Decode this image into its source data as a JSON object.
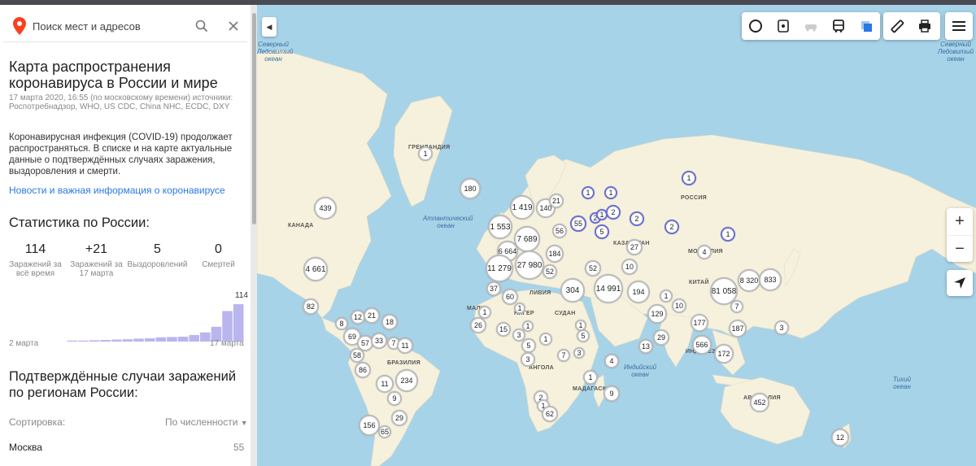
{
  "search": {
    "placeholder": "Поиск мест и адресов"
  },
  "sidebar": {
    "title": "Карта распространения коронавируса в России и мире",
    "meta": "17 марта 2020, 16:55 (по московскому времени) источники: Роспотребнадзор, WHO, US CDC, China NHC, ECDC, DXY",
    "description": "Коронавирусная инфекция (COVID-19) продолжает распространяться. В списке и на карте актуальные данные о подтверждённых случаях заражения, выздоровления и смерти.",
    "link": "Новости и важная информация о коронавирусе",
    "stats_heading": "Статистика по России:",
    "stats": [
      {
        "value": "114",
        "label": "Заражений за всё время"
      },
      {
        "value": "+21",
        "label": "Заражений за 17 марта"
      },
      {
        "value": "5",
        "label": "Выздоровлений"
      },
      {
        "value": "0",
        "label": "Смертей"
      }
    ],
    "regions_heading": "Подтверждённые случаи заражений по регионам России:",
    "sort_label": "Сортировка:",
    "sort_value": "По численности",
    "regions": [
      {
        "name": "Москва",
        "value": "55"
      }
    ]
  },
  "chart_data": {
    "type": "bar",
    "categories": [
      "2 марта",
      "",
      "",
      "",
      "",
      "",
      "",
      "",
      "",
      "",
      "",
      "",
      "",
      "",
      "",
      "17 марта"
    ],
    "values": [
      3,
      3,
      4,
      5,
      6,
      7,
      9,
      10,
      13,
      14,
      15,
      20,
      28,
      45,
      93,
      114
    ],
    "top_label": "114",
    "x_start_label": "2 марта",
    "x_end_label": "17 марта",
    "bar_color": "#b9b6ef"
  },
  "map": {
    "oceans": [
      {
        "name": "Северный Ледовитый океан"
      },
      {
        "name": "Атлантический океан"
      },
      {
        "name": "Индийский океан"
      },
      {
        "name": "Тихий океан"
      },
      {
        "name": "Северный Ледовитый океан"
      }
    ],
    "labels": [
      "ГРЕНЛАНДИЯ",
      "КАНАДА",
      "РОССИЯ",
      "КАЗАХСТАН",
      "МОНГОЛИЯ",
      "КИТАЙ",
      "ЛИВИЯ",
      "НИГЕР",
      "СУДАН",
      "АНГОЛА",
      "МАДАГАСКАР",
      "БРАЗИЛИЯ",
      "МАЛИ",
      "ИНДОНЕЗИЯ",
      "АВСТРАЛИЯ"
    ],
    "clusters": [
      {
        "value": "1"
      },
      {
        "value": "180"
      },
      {
        "value": "439"
      },
      {
        "value": "4 661"
      },
      {
        "value": "82"
      },
      {
        "value": "1 419"
      },
      {
        "value": "140"
      },
      {
        "value": "21"
      },
      {
        "value": "1 553"
      },
      {
        "value": "7 689"
      },
      {
        "value": "56"
      },
      {
        "value": "6 664"
      },
      {
        "value": "184"
      },
      {
        "value": "11 279"
      },
      {
        "value": "27 980"
      },
      {
        "value": "52"
      },
      {
        "value": "37"
      },
      {
        "value": "60"
      },
      {
        "value": "304"
      },
      {
        "value": "14 991"
      },
      {
        "value": "52"
      },
      {
        "value": "194"
      },
      {
        "value": "27"
      },
      {
        "value": "10"
      },
      {
        "value": "55"
      },
      {
        "value": "2"
      },
      {
        "value": "1"
      },
      {
        "value": "2"
      },
      {
        "value": "5"
      },
      {
        "value": "1"
      },
      {
        "value": "1"
      },
      {
        "value": "1"
      },
      {
        "value": "2"
      },
      {
        "value": "2"
      },
      {
        "value": "1"
      },
      {
        "value": "4"
      },
      {
        "value": "1"
      },
      {
        "value": "81 058"
      },
      {
        "value": "8 320"
      },
      {
        "value": "833"
      },
      {
        "value": "129"
      },
      {
        "value": "10"
      },
      {
        "value": "177"
      },
      {
        "value": "187"
      },
      {
        "value": "29"
      },
      {
        "value": "13"
      },
      {
        "value": "566"
      },
      {
        "value": "172"
      },
      {
        "value": "3"
      },
      {
        "value": "452"
      },
      {
        "value": "12"
      },
      {
        "value": "26"
      },
      {
        "value": "1"
      },
      {
        "value": "15"
      },
      {
        "value": "3"
      },
      {
        "value": "5"
      },
      {
        "value": "1"
      },
      {
        "value": "3"
      },
      {
        "value": "7"
      },
      {
        "value": "3"
      },
      {
        "value": "5"
      },
      {
        "value": "4"
      },
      {
        "value": "1"
      },
      {
        "value": "9"
      },
      {
        "value": "2"
      },
      {
        "value": "1"
      },
      {
        "value": "62"
      },
      {
        "value": "12"
      },
      {
        "value": "21"
      },
      {
        "value": "18"
      },
      {
        "value": "69"
      },
      {
        "value": "57"
      },
      {
        "value": "33"
      },
      {
        "value": "7"
      },
      {
        "value": "11"
      },
      {
        "value": "58"
      },
      {
        "value": "86"
      },
      {
        "value": "11"
      },
      {
        "value": "234"
      },
      {
        "value": "9"
      },
      {
        "value": "29"
      },
      {
        "value": "156"
      },
      {
        "value": "65"
      },
      {
        "value": "8"
      },
      {
        "value": "7"
      },
      {
        "value": "1"
      },
      {
        "value": "1"
      },
      {
        "value": "1"
      }
    ]
  }
}
